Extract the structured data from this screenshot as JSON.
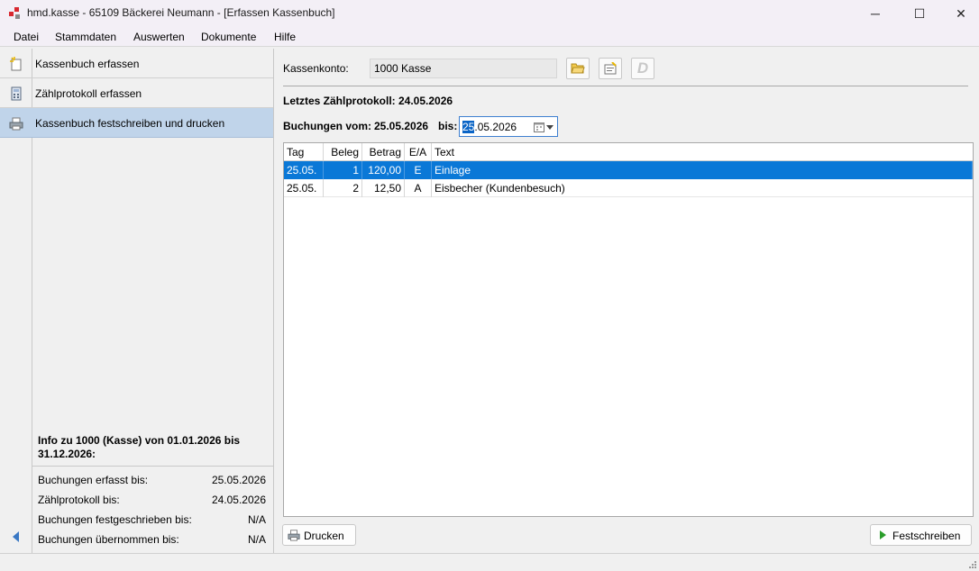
{
  "window": {
    "title": "hmd.kasse - 65109 Bäckerei Neumann - [Erfassen Kassenbuch]",
    "min_glyph": "─",
    "max_glyph": "☐",
    "close_glyph": "✕"
  },
  "menu": [
    "Datei",
    "Stammdaten",
    "Auswerten",
    "Dokumente",
    "Hilfe"
  ],
  "nav": {
    "items": [
      {
        "label": "Kassenbuch erfassen",
        "icon": "new-document-icon",
        "active": false
      },
      {
        "label": "Zählprotokoll erfassen",
        "icon": "calculator-icon",
        "active": false
      },
      {
        "label": "Kassenbuch festschreiben und drucken",
        "icon": "printer-icon",
        "active": true
      }
    ]
  },
  "info": {
    "heading": "Info zu 1000 (Kasse) von 01.01.2026 bis 31.12.2026:",
    "rows": [
      {
        "label": "Buchungen erfasst bis:",
        "value": "25.05.2026"
      },
      {
        "label": "Zählprotokoll bis:",
        "value": "24.05.2026"
      },
      {
        "label": "Buchungen festgeschrieben bis:",
        "value": "N/A"
      },
      {
        "label": "Buchungen übernommen bis:",
        "value": "N/A"
      }
    ]
  },
  "form": {
    "konto_label": "Kassenkonto:",
    "konto_value": "1000 Kasse",
    "d_button": "D",
    "letztes_label": "Letztes Zählprotokoll:",
    "letztes_value": "24.05.2026",
    "buchungen_label": "Buchungen vom:",
    "from_date": "25.05.2026",
    "bis_label": "bis:",
    "to_date_selected": "25",
    "to_date_rest": ".05.2026"
  },
  "table": {
    "columns": [
      "Tag",
      "Beleg",
      "Betrag",
      "E/A",
      "Text"
    ],
    "rows": [
      {
        "tag": "25.05.",
        "beleg": "1",
        "betrag": "120,00",
        "ea": "E",
        "text": "Einlage",
        "selected": true
      },
      {
        "tag": "25.05.",
        "beleg": "2",
        "betrag": "12,50",
        "ea": "A",
        "text": "Eisbecher (Kundenbesuch)",
        "selected": false
      }
    ]
  },
  "buttons": {
    "print": "Drucken",
    "commit": "Festschreiben"
  },
  "colors": {
    "selection": "#0a78d7",
    "nav_active": "#c0d4ea",
    "accent": "#3a78c4"
  }
}
